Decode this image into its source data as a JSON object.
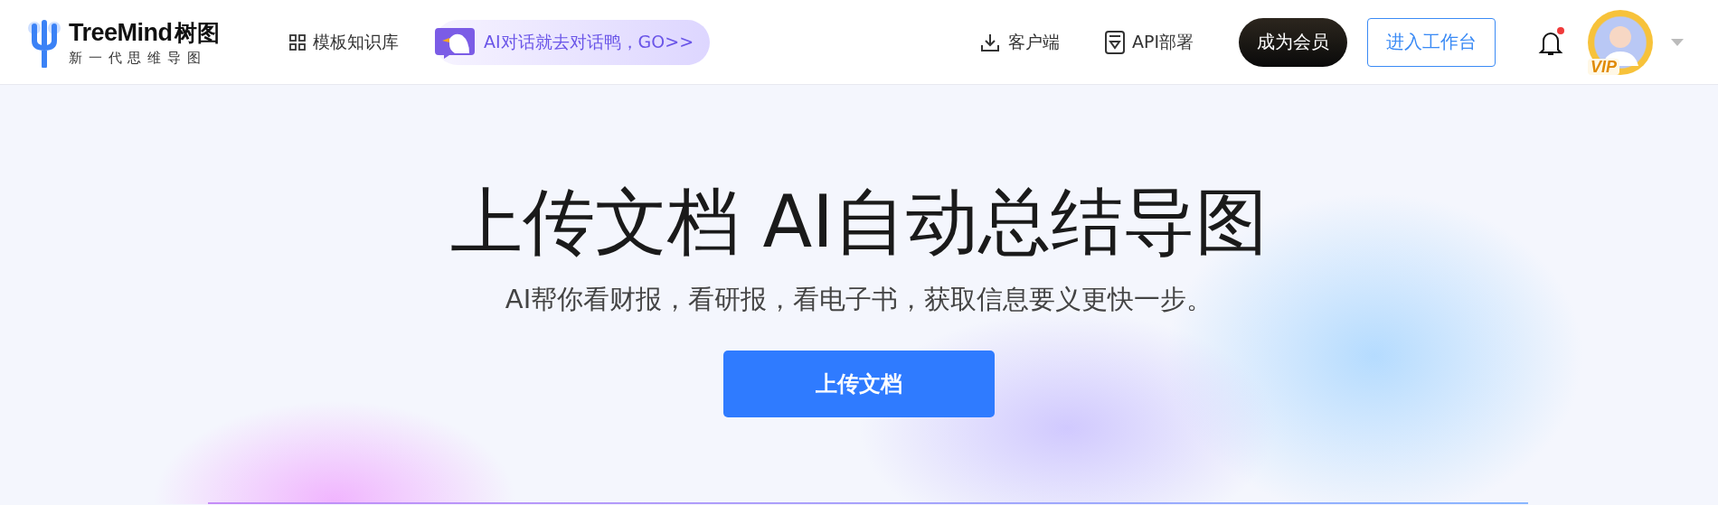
{
  "header": {
    "logo": {
      "name": "TreeMind",
      "name_cn": "树图",
      "tagline": "新 一 代 思 维 导 图"
    },
    "nav": [
      {
        "label": "模板知识库",
        "kind": "grid"
      },
      {
        "label": "AI对话就去对话鸭，GO>>",
        "kind": "promo"
      }
    ],
    "actions": [
      {
        "label": "客户端",
        "kind": "download"
      },
      {
        "label": "API部署",
        "kind": "api"
      },
      {
        "label": "成为会员",
        "kind": "dark"
      },
      {
        "label": "进入工作台",
        "kind": "outline"
      }
    ],
    "notifications": {
      "unread": true
    },
    "avatar": {
      "badge": "VIP"
    }
  },
  "hero": {
    "title": "上传文档 AI自动总结导图",
    "subtitle": "AI帮你看财报，看研报，看电子书，获取信息要义更快一步。",
    "button": "上传文档"
  }
}
